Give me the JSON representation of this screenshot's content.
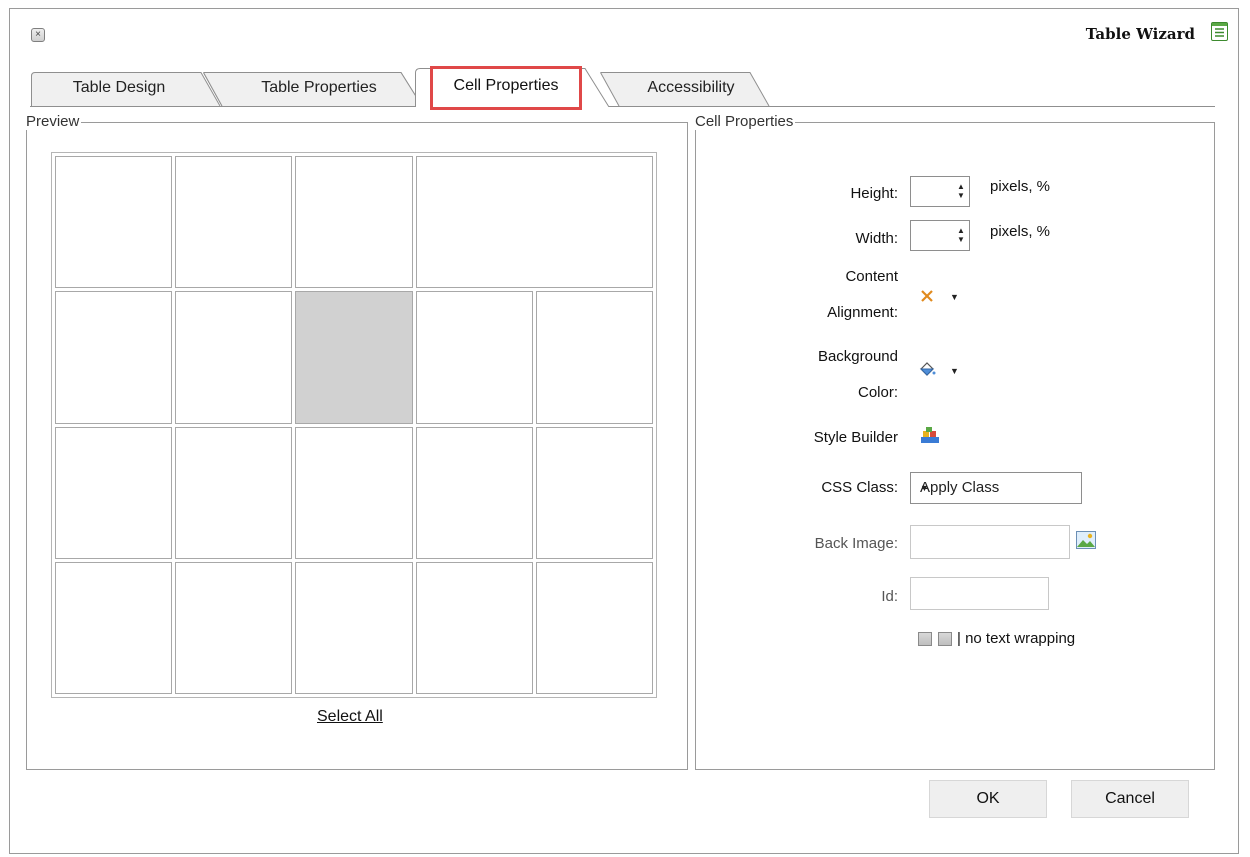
{
  "dialog": {
    "title": "Table Wizard",
    "close_glyph": "×"
  },
  "tabs": [
    {
      "label": "Table Design",
      "active": false
    },
    {
      "label": "Table Properties",
      "active": false
    },
    {
      "label": "Cell Properties",
      "active": true
    },
    {
      "label": "Accessibility",
      "active": false
    }
  ],
  "preview": {
    "legend": "Preview",
    "select_all": "Select All",
    "rows": [
      [
        1,
        1,
        1,
        2
      ],
      [
        1,
        1,
        1,
        1,
        1
      ],
      [
        1,
        1,
        1,
        1,
        1
      ],
      [
        1,
        1,
        1,
        1,
        1
      ]
    ],
    "selected_cell": {
      "row": 2,
      "col": 3
    }
  },
  "cell_properties": {
    "legend": "Cell Properties",
    "height_label": "Height:",
    "height_value": "",
    "width_label": "Width:",
    "width_value": "",
    "unit_text": "pixels, %",
    "content_alignment_label_1": "Content",
    "content_alignment_label_2": "Alignment:",
    "background_color_label_1": "Background",
    "background_color_label_2": "Color:",
    "style_builder_label": "Style Builder",
    "css_class_label": "CSS Class:",
    "css_class_value": "Apply Class",
    "back_image_label": "Back Image:",
    "back_image_value": "",
    "id_label": "Id:",
    "id_value": "",
    "no_wrap_label": "| no text wrapping"
  },
  "buttons": {
    "ok": "OK",
    "cancel": "Cancel"
  },
  "icons": {
    "close": "close-icon",
    "title": "table-wizard-icon",
    "alignment": "alignment-x-icon",
    "paint": "paint-bucket-icon",
    "style_builder": "style-builder-icon",
    "image_browse": "image-browse-icon"
  },
  "colors": {
    "highlight": "#e04848",
    "selected_cell": "#d1d1d1",
    "accent_green": "#3c8a2e"
  }
}
